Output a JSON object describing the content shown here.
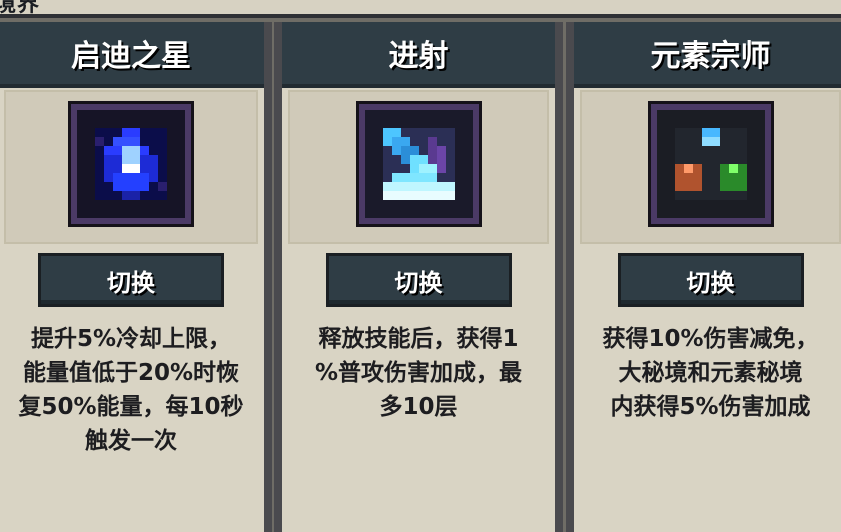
{
  "page": {
    "partial_title": "境界"
  },
  "cards": [
    {
      "title": "启迪之星",
      "icon": "blue-star-crystal-icon",
      "button": "切换",
      "description": "提升5%冷却上限，\n能量值低于20%时恢\n复50%能量，每10秒\n触发一次"
    },
    {
      "title": "进射",
      "icon": "ice-blade-wave-icon",
      "button": "切换",
      "description": "释放技能后，获得1\n%普攻伤害加成，最\n多10层"
    },
    {
      "title": "元素宗师",
      "icon": "element-orbs-icon",
      "button": "切换",
      "description": "获得10%伤害减免，\n大秘境和元素秘境\n内获得5%伤害加成"
    }
  ],
  "colors": {
    "header_bg": "#2f3d45",
    "card_bg": "#d9d4c4",
    "frame_purple": "#4b3a66",
    "text_dark": "#1d1d20"
  }
}
